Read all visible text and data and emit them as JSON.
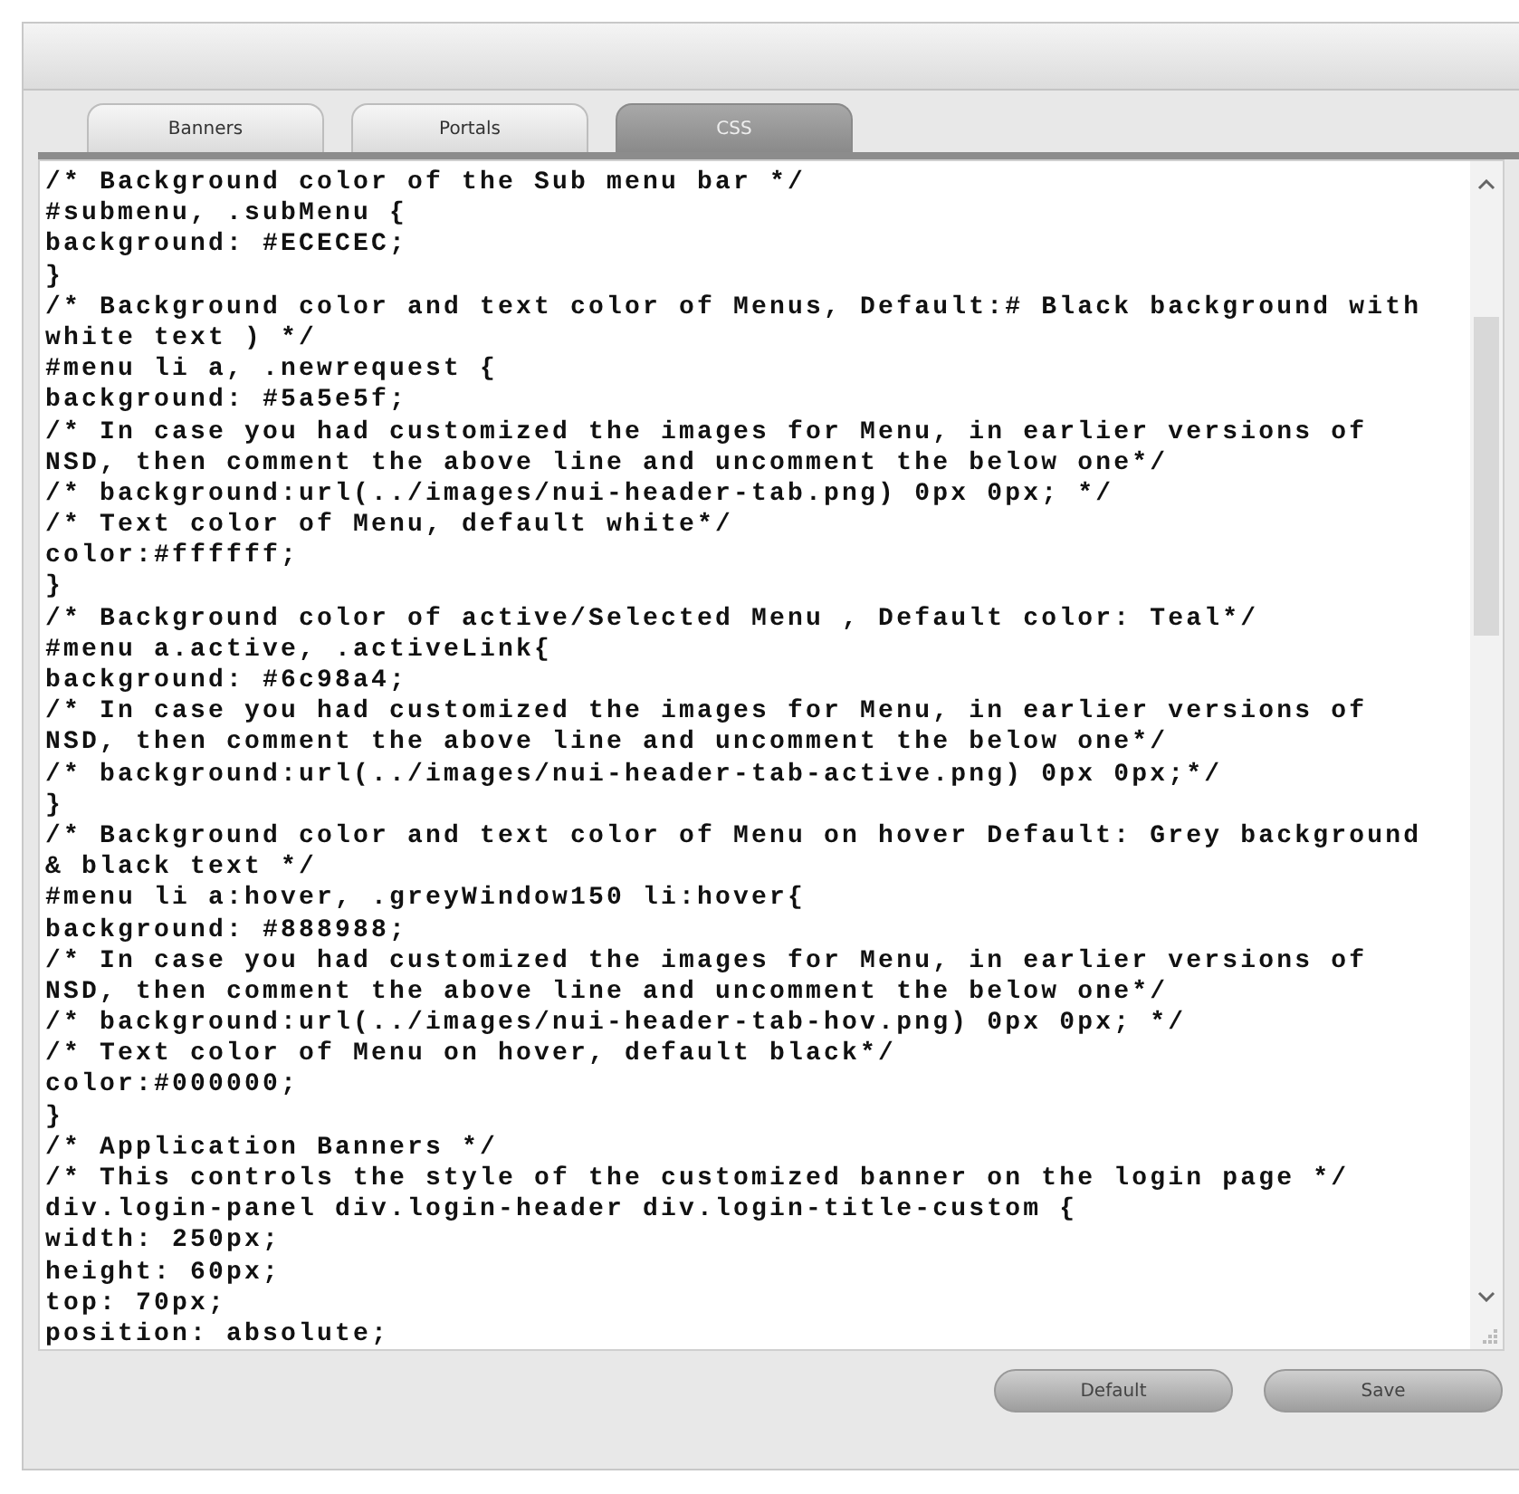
{
  "tabs": [
    {
      "label": "Banners",
      "selected": false
    },
    {
      "label": "Portals",
      "selected": false
    },
    {
      "label": "CSS",
      "selected": true
    }
  ],
  "editor": {
    "lines": [
      "/* Background color of the Sub menu bar */",
      "#submenu, .subMenu {",
      "background: #ECECEC;",
      "}",
      "/* Background color and text color of Menus, Default:# Black background with",
      "white text ) */",
      "#menu li a, .newrequest {",
      "background: #5a5e5f;",
      "/* In case you had customized the images for Menu, in earlier versions of",
      "NSD, then comment the above line and uncomment the below one*/",
      "/* background:url(../images/nui-header-tab.png) 0px 0px; */",
      "/* Text color of Menu, default white*/",
      "color:#ffffff;",
      "}",
      "/* Background color of active/Selected Menu , Default color: Teal*/",
      "#menu a.active, .activeLink{",
      "background: #6c98a4;",
      "/* In case you had customized the images for Menu, in earlier versions of",
      "NSD, then comment the above line and uncomment the below one*/",
      "/* background:url(../images/nui-header-tab-active.png) 0px 0px;*/",
      "}",
      "/* Background color and text color of Menu on hover Default: Grey background",
      "& black text */",
      "#menu li a:hover, .greyWindow150 li:hover{",
      "background: #888988;",
      "/* In case you had customized the images for Menu, in earlier versions of",
      "NSD, then comment the above line and uncomment the below one*/",
      "/* background:url(../images/nui-header-tab-hov.png) 0px 0px; */",
      "/* Text color of Menu on hover, default black*/",
      "color:#000000;",
      "}",
      "/* Application Banners */",
      "/* This controls the style of the customized banner on the login page */",
      "div.login-panel div.login-header div.login-title-custom {",
      "width: 250px;",
      "height: 60px;",
      "top: 70px;",
      "position: absolute;"
    ]
  },
  "buttons": [
    "Default",
    "Save"
  ]
}
